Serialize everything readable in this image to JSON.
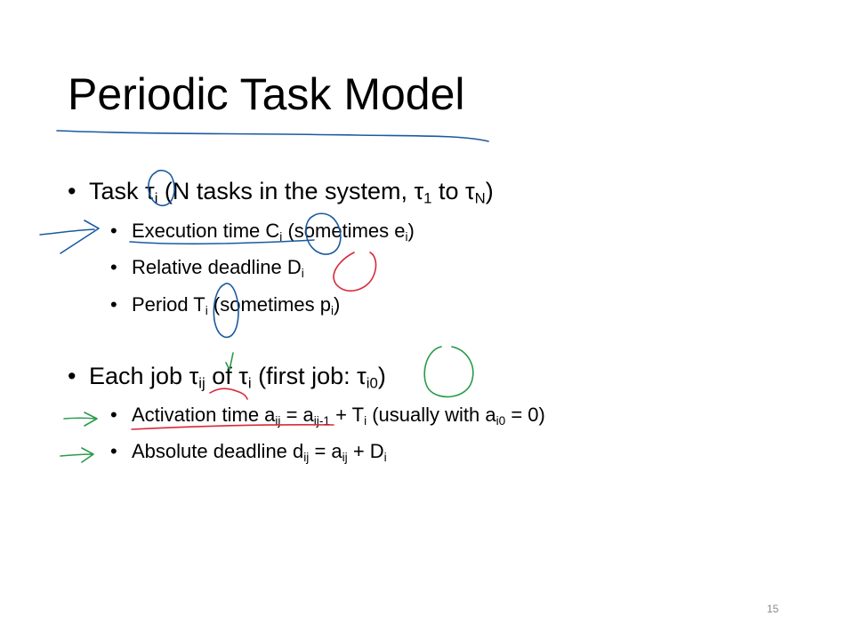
{
  "slide": {
    "title": "Periodic Task Model",
    "page_number": "15",
    "bullet_char": "•",
    "sections": [
      {
        "segments": [
          {
            "t": "Task τ"
          },
          {
            "sub": "i"
          },
          {
            "t": " (N tasks in the system, τ"
          },
          {
            "sub": "1"
          },
          {
            "t": " to τ"
          },
          {
            "sub": "N"
          },
          {
            "t": ")"
          }
        ],
        "items": [
          {
            "segments": [
              {
                "t": "Execution time C"
              },
              {
                "sub": "i"
              },
              {
                "t": " (sometimes e"
              },
              {
                "sub": "i"
              },
              {
                "t": ")"
              }
            ]
          },
          {
            "segments": [
              {
                "t": "Relative deadline D"
              },
              {
                "sub": "i"
              }
            ]
          },
          {
            "segments": [
              {
                "t": "Period T"
              },
              {
                "sub": "i"
              },
              {
                "t": " (sometimes p"
              },
              {
                "sub": "i"
              },
              {
                "t": ")"
              }
            ]
          }
        ]
      },
      {
        "segments": [
          {
            "t": "Each job τ"
          },
          {
            "sub": "ij"
          },
          {
            "t": " of τ"
          },
          {
            "sub": "i"
          },
          {
            "t": " (first job: τ"
          },
          {
            "sub": "i0"
          },
          {
            "t": ")"
          }
        ],
        "items": [
          {
            "segments": [
              {
                "t": "Activation time a"
              },
              {
                "sub": "ij"
              },
              {
                "t": " = a"
              },
              {
                "sub": "ij-1"
              },
              {
                "t": " + T"
              },
              {
                "sub": "i"
              },
              {
                "t": " (usually with a"
              },
              {
                "sub": "i0"
              },
              {
                "t": " = 0)"
              }
            ]
          },
          {
            "segments": [
              {
                "t": "Absolute deadline d"
              },
              {
                "sub": "ij"
              },
              {
                "t": " = a"
              },
              {
                "sub": "ij"
              },
              {
                "t": " + D"
              },
              {
                "sub": "i"
              }
            ]
          }
        ]
      }
    ]
  },
  "annotations": {
    "colors": {
      "blue": "#1b5aa0",
      "red": "#d72a3a",
      "green": "#2a9a4a"
    },
    "kind": "handwritten-ink"
  }
}
